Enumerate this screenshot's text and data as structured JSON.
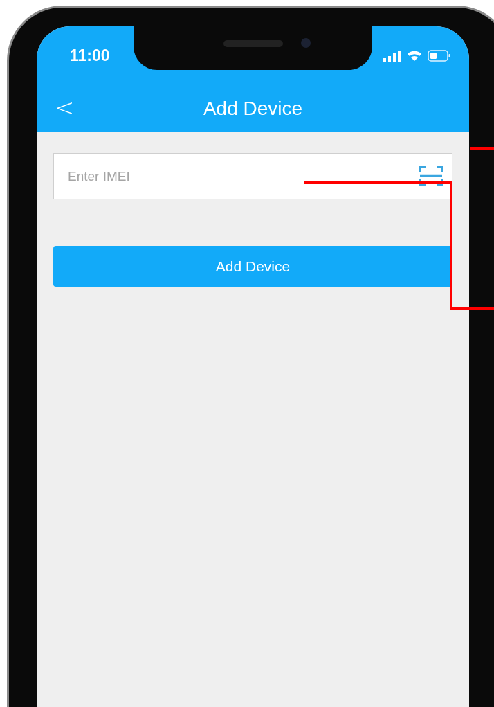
{
  "status_bar": {
    "time": "11:00"
  },
  "nav_bar": {
    "title": "Add Device",
    "back_icon": "<"
  },
  "imei_field": {
    "placeholder": "Enter IMEI"
  },
  "submit_button": {
    "label": "Add Device"
  }
}
